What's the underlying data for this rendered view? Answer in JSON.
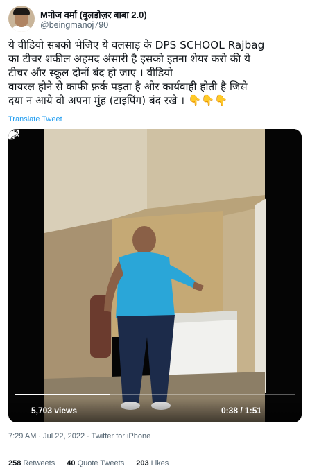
{
  "author": {
    "name": "Mनोज वर्मा (बुलडोज़र बाबा 2.0)",
    "handle": "@beingmanoj790"
  },
  "tweet": {
    "text": "ये वीडियो सबको भेजिए ये वलसाड़ के DPS SCHOOL  Rajbag\nका टीचर शकील अहमद अंसारी है इसको इतना शेयर करो की ये\nटीचर और स्कूल दोनों बंद हो जाए । वीडियो\nवायरल होने से काफी फ़र्क पड़ता है ओर कार्यवाही होती है जिसे\nदया न आये वो अपना मुंह (टाइपिंग) बंद रखे । 👇👇👇",
    "translate_label": "Translate Tweet"
  },
  "video": {
    "views_label": "5,703 views",
    "time_label": "0:38 / 1:51",
    "progress": 0.34,
    "play_icon": "play-icon",
    "mute_icon": "mute-icon",
    "expand_icon": "expand-icon"
  },
  "meta": {
    "timestamp": "7:29 AM · Jul 22, 2022 · Twitter for iPhone"
  },
  "stats": {
    "retweets_count": "258",
    "retweets_label": "Retweets",
    "quotes_count": "40",
    "quotes_label": "Quote Tweets",
    "likes_count": "203",
    "likes_label": "Likes"
  }
}
